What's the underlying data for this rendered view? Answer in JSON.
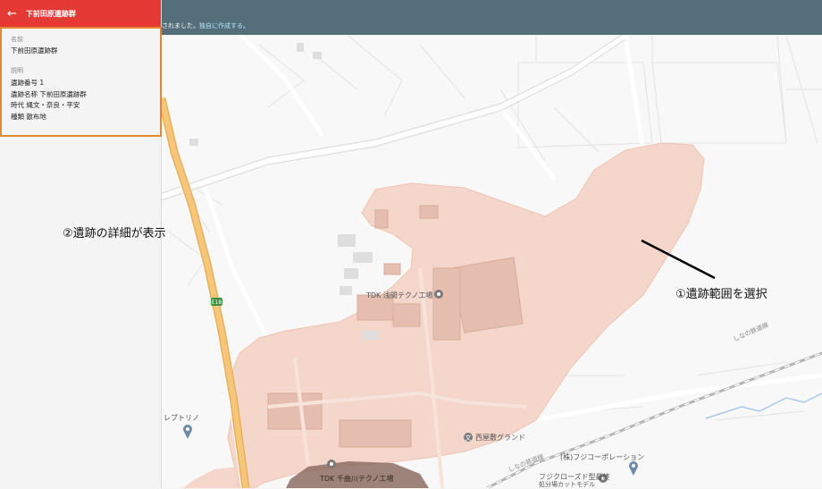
{
  "panel": {
    "title": "下前田原遺跡群",
    "name_label": "名前",
    "name_value": "下前田原遺跡群",
    "desc_label": "説明",
    "desc_lines": [
      "遺跡番号 1",
      "遺跡名称 下前田原遺跡群",
      "時代 縄文・奈良・平安",
      "種類 散布地"
    ]
  },
  "topbar": {
    "message": "されました。",
    "link": "独自に作成する。"
  },
  "callouts": {
    "detail": "②遺跡の詳細が表示",
    "range": "①遺跡範囲を選択"
  },
  "map": {
    "places": [
      {
        "key": "tdk_asama",
        "label": "TDK 浅間テクノ工場"
      },
      {
        "key": "nishiyashiki",
        "label": "西屋敷グランド"
      },
      {
        "key": "leptrino",
        "label": "レプトリノ"
      },
      {
        "key": "fujicorp",
        "label": "(株)フジコーポレーション"
      },
      {
        "key": "fujicorp_sub1",
        "label": "フジクローズド型最終"
      },
      {
        "key": "fujicorp_sub2",
        "label": "処分場カットモデル"
      },
      {
        "key": "tdk_chikuma",
        "label": "TDK 千曲川テクノ工場"
      }
    ],
    "rail_label": "しなの鉄道線",
    "road_label": "E18"
  },
  "colors": {
    "header": "#e53935",
    "topbar": "#546e7a",
    "highlight_border": "#e8872f",
    "site_fill": "#f3d3c6",
    "site_dark": "#8d6e63",
    "highway": "#f6c77a"
  }
}
